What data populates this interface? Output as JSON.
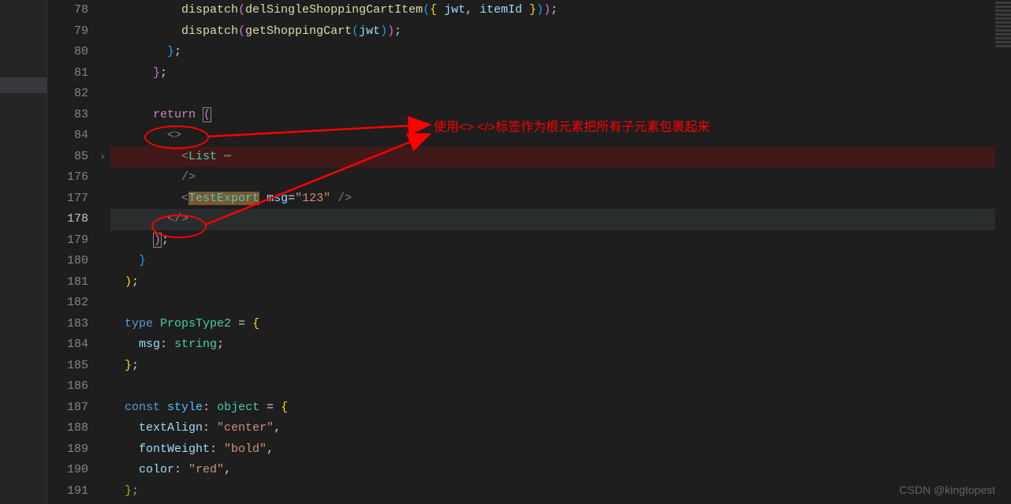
{
  "gutter": {
    "lines": [
      "78",
      "79",
      "80",
      "81",
      "82",
      "83",
      "84",
      "85",
      "176",
      "177",
      "178",
      "179",
      "180",
      "181",
      "182",
      "183",
      "184",
      "185",
      "186",
      "187",
      "188",
      "189",
      "190",
      "191"
    ],
    "currentLine": "178",
    "foldAtIndex": 7
  },
  "annotation": {
    "text": "使用<> </>标签作为根元素把所有子元素包裹起来"
  },
  "code": {
    "l78": {
      "prefix": "          ",
      "fn": "dispatch",
      "p1": "(",
      "fn2": "delSingleShoppingCartItem",
      "p2": "(",
      "b1": "{ ",
      "v1": "jwt",
      "comma": ", ",
      "v2": "itemId",
      "b2": " }",
      "p3": ")",
      "p4": ")",
      "semi": ";"
    },
    "l79": {
      "prefix": "          ",
      "fn": "dispatch",
      "p1": "(",
      "fn2": "getShoppingCart",
      "p2": "(",
      "v1": "jwt",
      "p3": ")",
      "p4": ")",
      "semi": ";"
    },
    "l80": {
      "prefix": "        ",
      "brace": "}",
      "semi": ";"
    },
    "l81": {
      "prefix": "      ",
      "brace": "}",
      "semi": ";"
    },
    "l83": {
      "prefix": "      ",
      "kw": "return",
      "sp": " ",
      "p1": "("
    },
    "l84": {
      "prefix": "        ",
      "open": "<>"
    },
    "l85": {
      "prefix": "          ",
      "lt": "<",
      "tag": "List",
      "dots": " ⋯"
    },
    "l176": {
      "prefix": "          ",
      "close": "/>"
    },
    "l177": {
      "prefix": "          ",
      "lt": "<",
      "tag": "TestExport",
      "sp": " ",
      "attr": "msg",
      "eq": "=",
      "val": "\"123\"",
      "sp2": " ",
      "close": "/>"
    },
    "l178": {
      "prefix": "        ",
      "close": "</>"
    },
    "l179": {
      "prefix": "      ",
      "p1": ")",
      "semi": ";"
    },
    "l180": {
      "prefix": "    ",
      "brace": "}"
    },
    "l181": {
      "prefix": "  ",
      "p1": ")",
      "semi": ";"
    },
    "l183": {
      "prefix": "  ",
      "kw": "type",
      "sp": " ",
      "name": "PropsType2",
      "sp2": " ",
      "eq": "=",
      "sp3": " ",
      "brace": "{"
    },
    "l184": {
      "prefix": "    ",
      "prop": "msg",
      "colon": ": ",
      "type": "string",
      "semi": ";"
    },
    "l185": {
      "prefix": "  ",
      "brace": "}",
      "semi": ";"
    },
    "l187": {
      "prefix": "  ",
      "kw": "const",
      "sp": " ",
      "name": "style",
      "colon": ": ",
      "type": "object",
      "sp2": " ",
      "eq": "=",
      "sp3": " ",
      "brace": "{"
    },
    "l188": {
      "prefix": "    ",
      "prop": "textAlign",
      "colon": ": ",
      "val": "\"center\"",
      "comma": ","
    },
    "l189": {
      "prefix": "    ",
      "prop": "fontWeight",
      "colon": ": ",
      "val": "\"bold\"",
      "comma": ","
    },
    "l190": {
      "prefix": "    ",
      "prop": "color",
      "colon": ": ",
      "val": "\"red\"",
      "comma": ","
    },
    "l191": {
      "prefix": "  ",
      "brace": "}",
      "semi": ";"
    }
  },
  "watermark": "CSDN @kingtopest"
}
